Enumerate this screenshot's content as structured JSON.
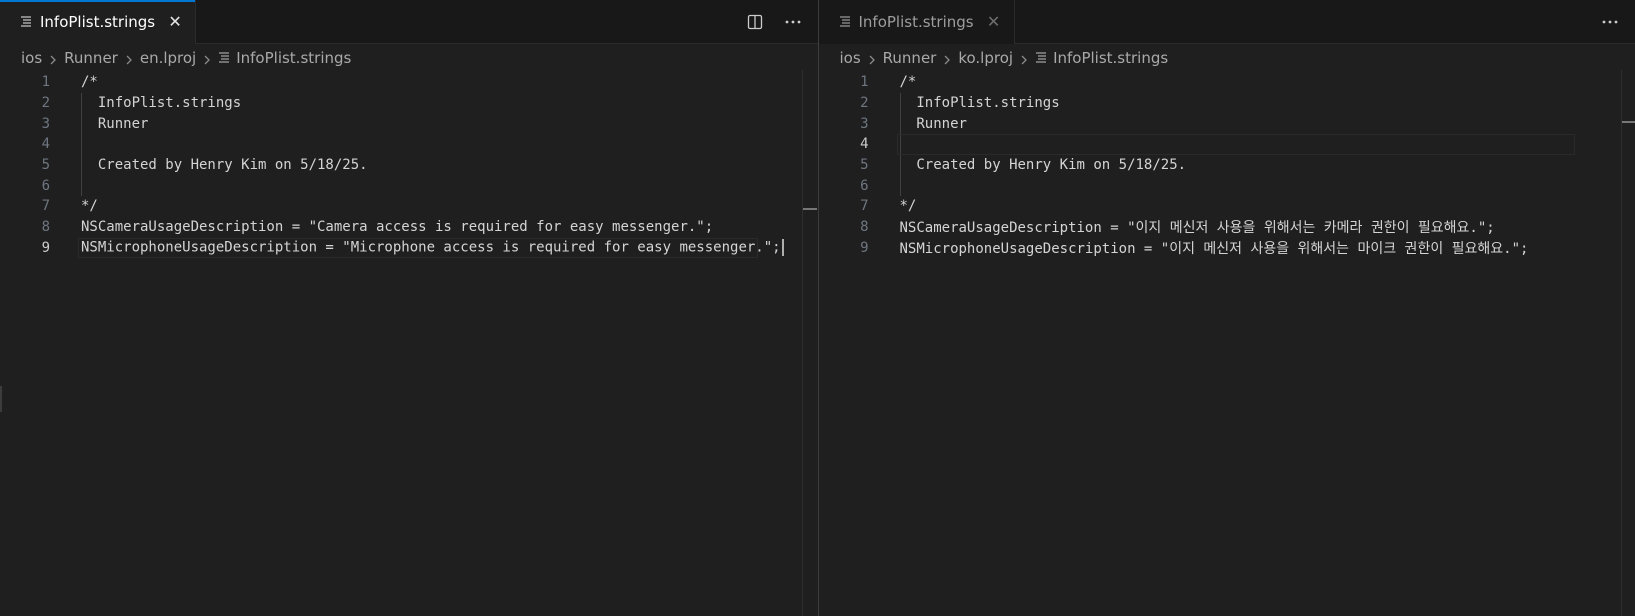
{
  "left_pane": {
    "tab": {
      "label": "InfoPlist.strings",
      "close": "✕"
    },
    "breadcrumb": [
      "ios",
      "Runner",
      "en.lproj",
      "InfoPlist.strings"
    ],
    "lines": [
      {
        "num": "1",
        "text": "/*"
      },
      {
        "num": "2",
        "text": "  InfoPlist.strings"
      },
      {
        "num": "3",
        "text": "  Runner"
      },
      {
        "num": "4",
        "text": ""
      },
      {
        "num": "5",
        "text": "  Created by Henry Kim on 5/18/25."
      },
      {
        "num": "6",
        "text": ""
      },
      {
        "num": "7",
        "text": "*/"
      },
      {
        "num": "8",
        "text": "NSCameraUsageDescription = \"Camera access is required for easy messenger.\";"
      },
      {
        "num": "9",
        "text": "NSMicrophoneUsageDescription = \"Microphone access is required for easy messenger.\";"
      }
    ],
    "current_line": 9
  },
  "right_pane": {
    "tab": {
      "label": "InfoPlist.strings",
      "close": "✕"
    },
    "breadcrumb": [
      "ios",
      "Runner",
      "ko.lproj",
      "InfoPlist.strings"
    ],
    "lines": [
      {
        "num": "1",
        "text": "/*"
      },
      {
        "num": "2",
        "text": "  InfoPlist.strings"
      },
      {
        "num": "3",
        "text": "  Runner"
      },
      {
        "num": "4",
        "text": ""
      },
      {
        "num": "5",
        "text": "  Created by Henry Kim on 5/18/25."
      },
      {
        "num": "6",
        "text": ""
      },
      {
        "num": "7",
        "text": "*/"
      },
      {
        "num": "8",
        "text": "NSCameraUsageDescription = \"이지 메신저 사용을 위해서는 카메라 권한이 필요해요.\";"
      },
      {
        "num": "9",
        "text": "NSMicrophoneUsageDescription = \"이지 메신저 사용을 위해서는 마이크 권한이 필요해요.\";"
      }
    ],
    "current_line": 4
  },
  "theme": {
    "accent": "#0078d4",
    "background": "#1f1f1f",
    "tabbar": "#181818"
  },
  "icons": {
    "file": "lines-file-icon",
    "split": "split-editor-icon",
    "more": "more-actions-icon",
    "chevron": "chevron-right-icon"
  }
}
